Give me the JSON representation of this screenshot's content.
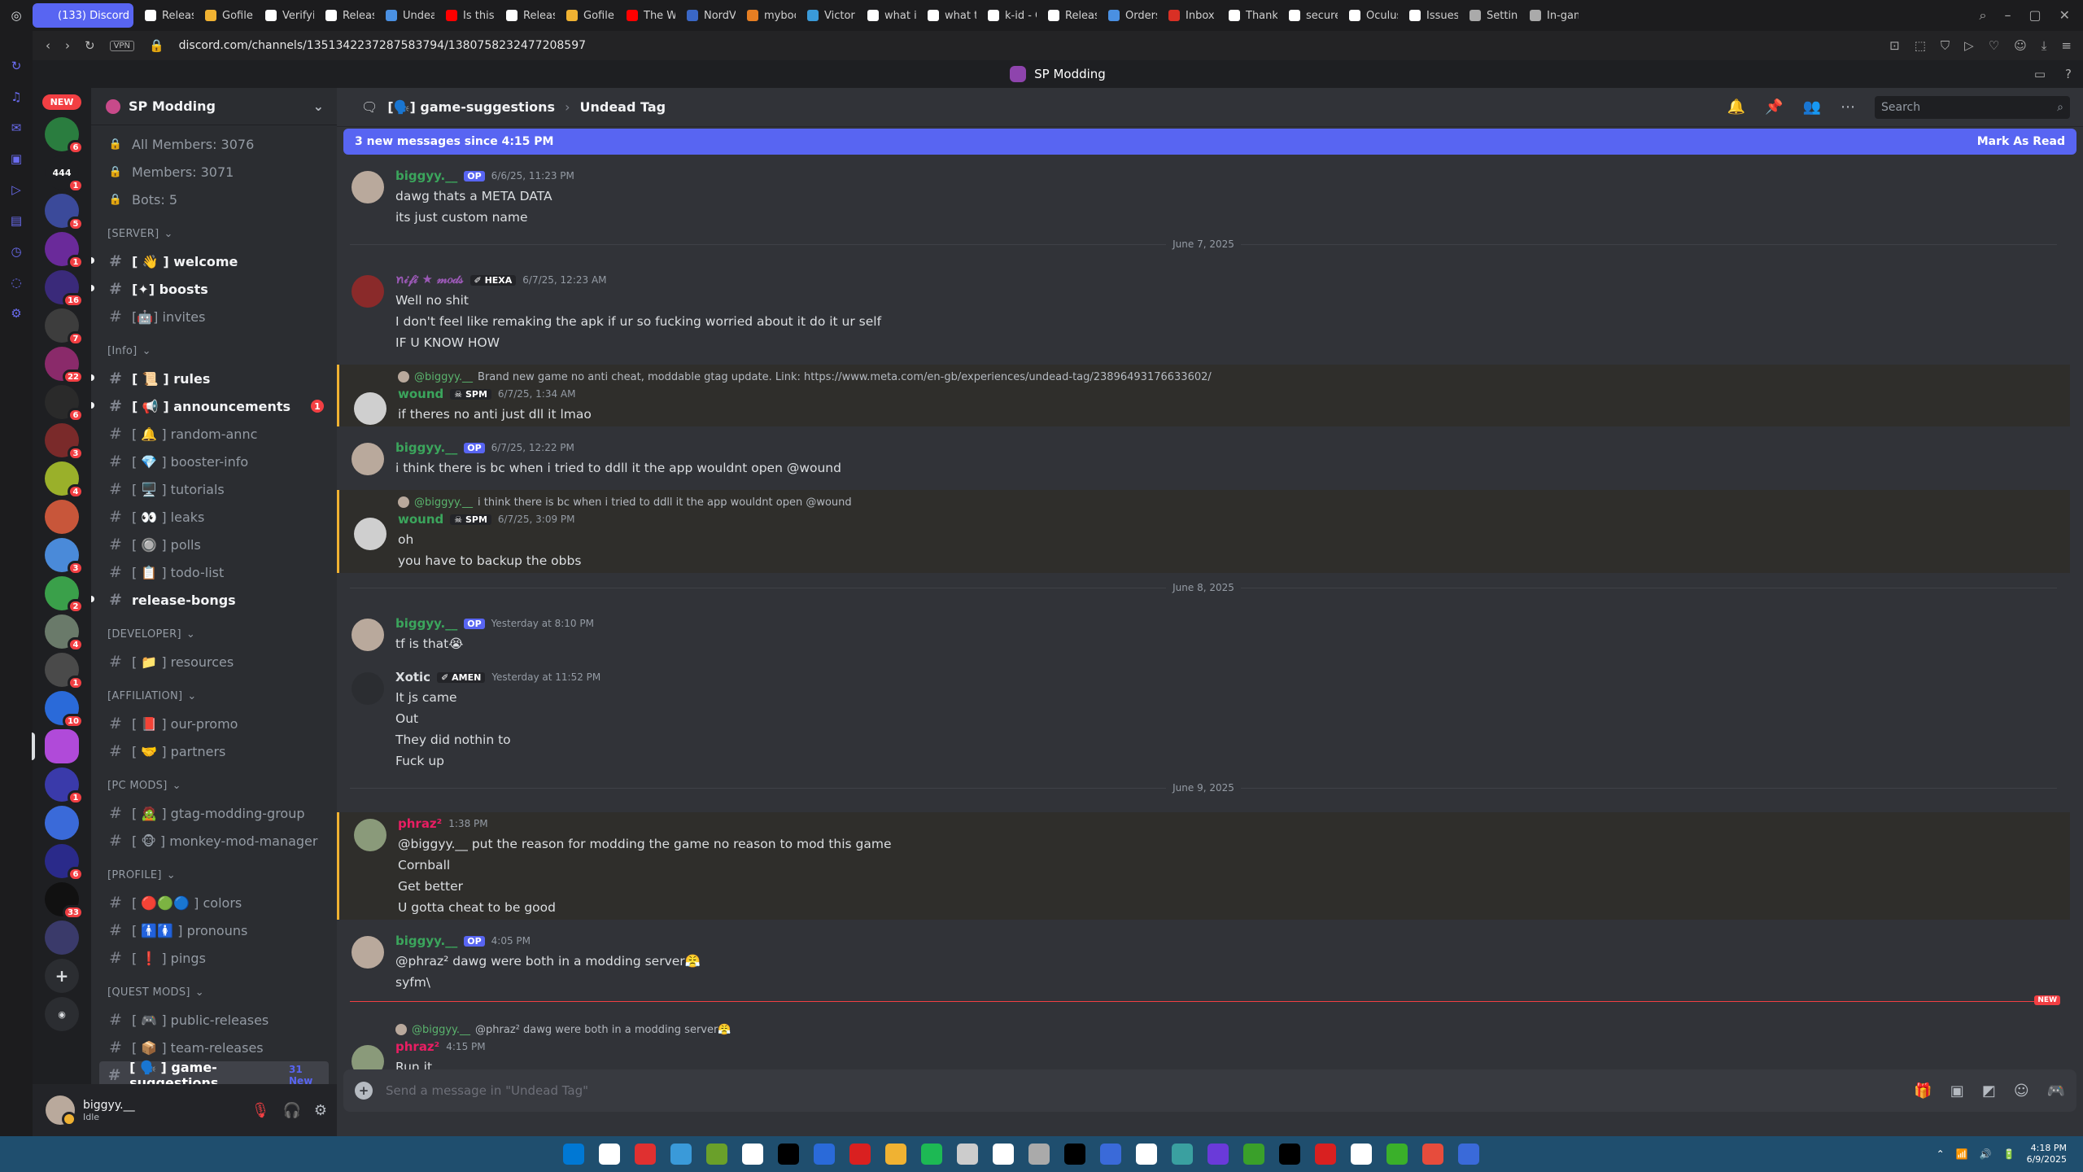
{
  "browser": {
    "tabs": [
      {
        "label": "(133) Discord | \"",
        "active": true,
        "color": "#5865f2"
      },
      {
        "label": "Release",
        "color": "#ffffff"
      },
      {
        "label": "Gofile -",
        "color": "#f0b232"
      },
      {
        "label": "Verifying",
        "color": "#ffffff"
      },
      {
        "label": "Release",
        "color": "#ffffff"
      },
      {
        "label": "Undead",
        "color": "#4a90e2"
      },
      {
        "label": "Is this th",
        "color": "#ff0000"
      },
      {
        "label": "Release",
        "color": "#ffffff"
      },
      {
        "label": "Gofile -",
        "color": "#f0b232"
      },
      {
        "label": "The Win",
        "color": "#ff0000"
      },
      {
        "label": "NordVPI",
        "color": "#3a67c6"
      },
      {
        "label": "mybook",
        "color": "#e67e22"
      },
      {
        "label": "Victor E",
        "color": "#3a9ad9"
      },
      {
        "label": "what is",
        "color": "#ffffff"
      },
      {
        "label": "what tin",
        "color": "#ffffff"
      },
      {
        "label": "k-id - G",
        "color": "#ffffff"
      },
      {
        "label": "Release",
        "color": "#ffffff"
      },
      {
        "label": "Orders",
        "color": "#4a90e2"
      },
      {
        "label": "Inbox (6",
        "color": "#d93025"
      },
      {
        "label": "Thank Y",
        "color": "#ffffff"
      },
      {
        "label": "secure.",
        "color": "#ffffff"
      },
      {
        "label": "Oculus",
        "color": "#ffffff"
      },
      {
        "label": "Issues",
        "color": "#ffffff"
      },
      {
        "label": "Settings",
        "color": "#aaaaaa"
      },
      {
        "label": "In-game",
        "color": "#aaaaaa"
      }
    ],
    "vpn_label": "VPN",
    "url": "discord.com/channels/1351342237287583794/1380758232477208597",
    "window_title": "SP Modding"
  },
  "guilds": {
    "new_label": "NEW",
    "items": [
      {
        "label": "",
        "badge": "6",
        "color": "#2a7d3f"
      },
      {
        "label": "444",
        "badge": "1",
        "color": "#1e1f22"
      },
      {
        "label": "",
        "badge": "5",
        "color": "#3b4a9a"
      },
      {
        "label": "",
        "badge": "1",
        "color": "#6a2a9a"
      },
      {
        "label": "",
        "badge": "16",
        "color": "#3a2a7a"
      },
      {
        "label": "",
        "badge": "7",
        "color": "#3d3d3d"
      },
      {
        "label": "",
        "badge": "22",
        "color": "#8a2a6a"
      },
      {
        "label": "",
        "badge": "6",
        "color": "#2a2a2a"
      },
      {
        "label": "",
        "badge": "3",
        "color": "#7a2a2a"
      },
      {
        "label": "",
        "badge": "4",
        "color": "#9ab02a"
      },
      {
        "label": "",
        "badge": "",
        "color": "#c8563a"
      },
      {
        "label": "",
        "badge": "3",
        "color": "#4a8ad9"
      },
      {
        "label": "",
        "badge": "2",
        "color": "#3aa04a"
      },
      {
        "label": "",
        "badge": "4",
        "color": "#6a7a6a"
      },
      {
        "label": "",
        "badge": "1",
        "color": "#4a4a4a"
      },
      {
        "label": "",
        "badge": "10",
        "color": "#2a6ad9"
      },
      {
        "label": "",
        "badge": "",
        "color": "#b04ad9",
        "selected": true
      },
      {
        "label": "",
        "badge": "1",
        "color": "#3a3aaa"
      },
      {
        "label": "",
        "badge": "",
        "color": "#3a6ad9"
      },
      {
        "label": "",
        "badge": "6",
        "color": "#2a2a8a"
      },
      {
        "label": "",
        "badge": "33",
        "color": "#111111"
      },
      {
        "label": "",
        "badge": "",
        "color": "#3a3a6a"
      }
    ]
  },
  "server": {
    "name": "SP Modding"
  },
  "channels": {
    "stats": [
      {
        "label": "All Members: 3076"
      },
      {
        "label": "Members: 3071"
      },
      {
        "label": "Bots: 5"
      }
    ],
    "groups": [
      {
        "category": "[SERVER]",
        "items": [
          {
            "name": "[ 👋 ]  welcome",
            "bold": true,
            "unread": true
          },
          {
            "name": "[✦]  boosts",
            "bold": true,
            "unread": true
          },
          {
            "name": "[🤖]  invites"
          }
        ]
      },
      {
        "category": "[Info]",
        "items": [
          {
            "name": "[ 📜 ]  rules",
            "bold": true,
            "unread": true
          },
          {
            "name": "[ 📢 ]  announcements",
            "bold": true,
            "unread": true,
            "mention": "1"
          },
          {
            "name": "[ 🔔 ]  random-annc"
          },
          {
            "name": "[ 💎 ]  booster-info"
          },
          {
            "name": "[ 🖥️ ]  tutorials"
          },
          {
            "name": "[ 👀 ]  leaks"
          },
          {
            "name": "[ 🔘 ]  polls"
          },
          {
            "name": "[ 📋 ]  todo-list"
          },
          {
            "name": "release-bongs",
            "bold": true,
            "unread": true
          }
        ]
      },
      {
        "category": "[DEVELOPER]",
        "items": [
          {
            "name": "[ 📁 ]  resources"
          }
        ]
      },
      {
        "category": "[AFFILIATION]",
        "items": [
          {
            "name": "[ 📕 ]  our-promo"
          },
          {
            "name": "[ 🤝 ]  partners"
          }
        ]
      },
      {
        "category": "[PC MODS]",
        "items": [
          {
            "name": "[ 🧟 ]  gtag-modding-group"
          },
          {
            "name": "[ 🐵 ]  monkey-mod-manager"
          }
        ]
      },
      {
        "category": "[PROFILE]",
        "items": [
          {
            "name": "[ 🔴🟢🔵 ]  colors"
          },
          {
            "name": "[ 🚹🚺 ]  pronouns"
          },
          {
            "name": "[ ❗ ]  pings"
          }
        ]
      },
      {
        "category": "[QUEST MODS]",
        "items": [
          {
            "name": "[ 🎮 ]  public-releases"
          },
          {
            "name": "[ 📦 ]  team-releases"
          },
          {
            "name": "[ 🗣️ ]  game-suggestions",
            "bold": true,
            "active": true,
            "newtag": "31 New"
          }
        ]
      }
    ]
  },
  "user": {
    "name": "biggyy.__",
    "status": "Idle"
  },
  "header": {
    "channel": "[🗣️] game-suggestions",
    "thread": "Undead Tag",
    "search_placeholder": "Search"
  },
  "new_messages": {
    "text": "3 new messages since 4:15 PM",
    "action": "Mark As Read"
  },
  "messages": [
    {
      "type": "msg",
      "author": "biggyy.__",
      "author_color": "#3ba55c",
      "tag": "OP",
      "time": "6/6/25, 11:23 PM",
      "avatar": "#b9a99c",
      "lines": [
        "dawg thats a META DATA",
        "its just custom name"
      ]
    },
    {
      "type": "day",
      "label": "June 7, 2025"
    },
    {
      "type": "msg",
      "author": "ꪀ𝒾𝒻𝒾 ★ 𝓂𝑜𝒹𝓈",
      "author_color": "#9b59b6",
      "tag2": "✐ HEXA",
      "time": "6/7/25, 12:23 AM",
      "avatar": "#8a2a2a",
      "lines": [
        "Well no shit",
        "I don't feel like remaking the apk if ur so fucking worried about it do it ur self",
        "IF U KNOW HOW"
      ]
    },
    {
      "type": "msg",
      "hl": true,
      "reply_author": "@biggyy.__",
      "reply_text": "Brand new game no anti cheat, moddable gtag update. Link: https://www.meta.com/en-gb/experiences/undead-tag/23896493176633602/",
      "author": "wound",
      "author_color": "#3ba55c",
      "tag2": "☠ SPM",
      "time": "6/7/25, 1:34 AM",
      "avatar": "#cfcfcf",
      "lines": [
        "if theres no anti just dll it lmao"
      ]
    },
    {
      "type": "msg",
      "author": "biggyy.__",
      "author_color": "#3ba55c",
      "tag": "OP",
      "time": "6/7/25, 12:22 PM",
      "avatar": "#b9a99c",
      "lines": [
        "i think there is bc when i tried to ddll it the app wouldnt open @wound"
      ]
    },
    {
      "type": "msg",
      "hl": true,
      "reply_author": "@biggyy.__",
      "reply_text": "i think there is bc when i tried to ddll it the app wouldnt open @wound",
      "author": "wound",
      "author_color": "#3ba55c",
      "tag2": "☠ SPM",
      "time": "6/7/25, 3:09 PM",
      "avatar": "#cfcfcf",
      "lines": [
        "oh",
        "you have to backup the obbs"
      ]
    },
    {
      "type": "day",
      "label": "June 8, 2025"
    },
    {
      "type": "msg",
      "author": "biggyy.__",
      "author_color": "#3ba55c",
      "tag": "OP",
      "time": "Yesterday at 8:10 PM",
      "avatar": "#b9a99c",
      "lines": [
        "tf is that😭"
      ]
    },
    {
      "type": "msg",
      "author": "Xotic",
      "author_color": "#dbdee1",
      "tag2": "✐ AMEN",
      "time": "Yesterday at 11:52 PM",
      "avatar": "#2b2d31",
      "lines": [
        "It js came",
        "Out",
        "They did nothin to",
        "Fuck up"
      ]
    },
    {
      "type": "day",
      "label": "June 9, 2025"
    },
    {
      "type": "msg",
      "hl": true,
      "author": "phraz²",
      "author_color": "#e91e63",
      "time": "1:38 PM",
      "avatar": "#8a9a7a",
      "lines": [
        "@biggyy.__ put the reason for modding the game no reason to mod this game",
        "Cornball",
        "Get better",
        "U gotta cheat to be good"
      ]
    },
    {
      "type": "msg",
      "author": "biggyy.__",
      "author_color": "#3ba55c",
      "tag": "OP",
      "time": "4:05 PM",
      "avatar": "#b9a99c",
      "lines": [
        "@phraz² dawg were both in a modding server😤",
        "syfm\\"
      ]
    },
    {
      "type": "new",
      "label": "NEW"
    },
    {
      "type": "msg",
      "reply_author": "@biggyy.__",
      "reply_text": "@phraz² dawg were both in a modding server😤",
      "author": "phraz²",
      "author_color": "#e91e63",
      "time": "4:15 PM",
      "avatar": "#8a9a7a",
      "lines": [
        "Run it",
        "You mod",
        "Im legit"
      ]
    }
  ],
  "composer": {
    "placeholder": "Send a message in \"Undead Tag\""
  },
  "taskbar": {
    "time": "4:18 PM",
    "date": "6/9/2025",
    "apps": [
      "#0078d4",
      "#ffffff",
      "#e03030",
      "#3a9ad9",
      "#6aa02a",
      "#ffffff",
      "#000000",
      "#2a6ad9",
      "#d92020",
      "#f0b232",
      "#1db954",
      "#cccccc",
      "#ffffff",
      "#aaaaaa",
      "#000000",
      "#3a6ad9",
      "#ffffff",
      "#3aa0a0",
      "#6a3ad9",
      "#3aa02a",
      "#000000",
      "#d92020",
      "#ffffff",
      "#3ab02a",
      "#e74c3c",
      "#3a6ad9"
    ]
  }
}
